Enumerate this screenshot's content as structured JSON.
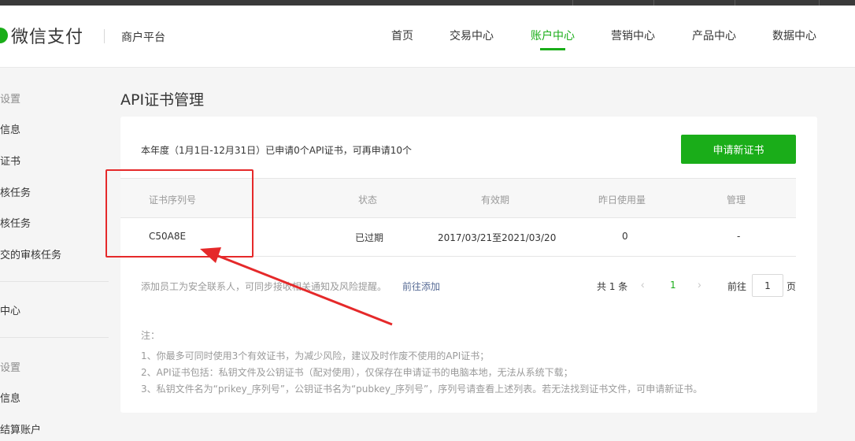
{
  "header": {
    "logo_text": "微信支付",
    "logo_sub": "商户平台",
    "nav": [
      {
        "label": "首页",
        "active": false
      },
      {
        "label": "交易中心",
        "active": false
      },
      {
        "label": "账户中心",
        "active": true
      },
      {
        "label": "营销中心",
        "active": false
      },
      {
        "label": "产品中心",
        "active": false
      },
      {
        "label": "数据中心",
        "active": false
      }
    ]
  },
  "sidebar": {
    "items": [
      {
        "label": "设置",
        "type": "head"
      },
      {
        "label": "信息",
        "type": "item"
      },
      {
        "label": "证书",
        "type": "item"
      },
      {
        "label": "核任务",
        "type": "item"
      },
      {
        "label": "核任务",
        "type": "item"
      },
      {
        "label": "交的审核任务",
        "type": "item"
      },
      {
        "label": "中心",
        "type": "item"
      },
      {
        "label": "设置",
        "type": "head"
      },
      {
        "label": "信息",
        "type": "item"
      },
      {
        "label": "结算账户",
        "type": "item"
      }
    ]
  },
  "page": {
    "title": "API证书管理",
    "summary": "本年度（1月1日-12月31日）已申请0个API证书，可再申请10个",
    "apply_button": "申请新证书"
  },
  "table": {
    "columns": [
      "证书序列号",
      "状态",
      "有效期",
      "昨日使用量",
      "管理"
    ],
    "rows": [
      {
        "serial": "C50A8E",
        "status": "已过期",
        "validity": "2017/03/21至2021/03/20",
        "usage": "0",
        "manage": "-"
      }
    ]
  },
  "footer": {
    "note": "添加员工为安全联系人，可同步接收相关通知及风险提醒。",
    "link": "前往添加"
  },
  "pagination": {
    "total_text": "共 1 条",
    "prev_icon": "chevron-left-icon",
    "current_page": "1",
    "next_icon": "chevron-right-icon",
    "goto_label": "前往",
    "input_value": "1",
    "unit": "页"
  },
  "notes": {
    "title": "注：",
    "lines": [
      "1、你最多可同时使用3个有效证书，为减少风险，建议及时作废不使用的API证书；",
      "2、API证书包括：私钥文件及公钥证书（配对使用），仅保存在申请证书的电脑本地，无法从系统下载；",
      "3、私钥文件名为“prikey_序列号”，公钥证书名为“pubkey_序列号”，序列号请查看上述列表。若无法找到证书文件，可申请新证书。"
    ]
  },
  "colors": {
    "brand_green": "#1aad19",
    "link_blue": "#576b95",
    "annotation_red": "#e5292a"
  }
}
